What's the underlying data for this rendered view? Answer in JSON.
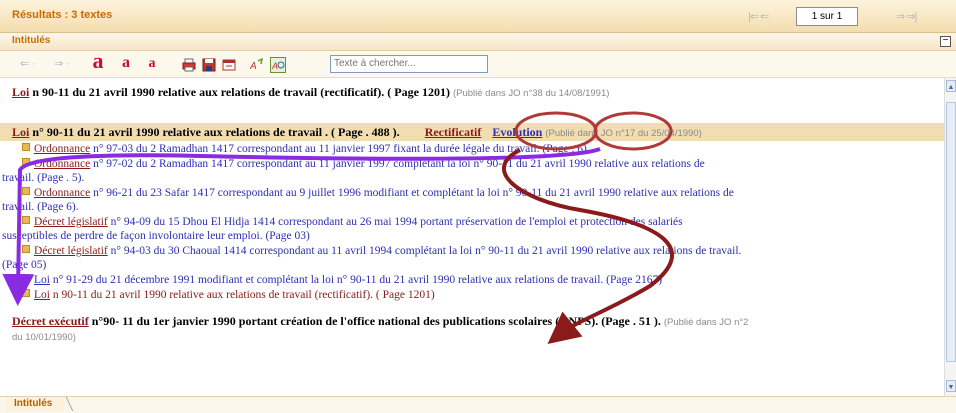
{
  "results": {
    "title": "Résultats : 3 textes",
    "page_indicator": "1 sur 1",
    "nav_prev": "|⇐ ⇐",
    "nav_next": "⇒ ⇒|"
  },
  "section": {
    "title": "Intitulés",
    "collapse": "−"
  },
  "toolbar": {
    "nav_back": "⇐ ·",
    "nav_fwd": "⇒ ·",
    "font_big": "a",
    "font_mid": "a",
    "font_small": "a",
    "search_placeholder": "Texte à chercher..."
  },
  "content": {
    "entry1": {
      "link": "Loi",
      "text": " n 90-11 du 21 avril 1990 relative aux relations de travail (rectificatif). ( Page 1201)",
      "pub": "(Publié dans JO n°38 du 14/08/1991)"
    },
    "entry2": {
      "link": "Loi",
      "text": " n° 90-11 du 21 avril 1990 relative aux relations de travail . ( Page . 488 ).",
      "btn_rectificatif": "Rectificatif",
      "btn_evolution": "Evolution",
      "pub": "(Publié dans JO n°17 du 25/04/1990)"
    },
    "subitems": [
      {
        "link": "Ordonnance",
        "text": " n° 97-03 du 2 Ramadhan 1417  correspondant au 11 janvier 1997 fixant la durée légale du travail. (Page . 6)."
      },
      {
        "link": "Ordonnance",
        "text": " n° 97-02 du 2 Ramadhan 1417  correspondant au 11 janvier 1997 complétant  la loi n° 90-11 du 21 avril 1990 relative aux relations de",
        "cont": "travail. (Page . 5)."
      },
      {
        "link": "Ordonnance",
        "text": " n° 96-21 du 23 Safar 1417 correspondant au 9 juillet 1996 modifiant et complétant la loi n° 90-11  du 21 avril 1990 relative aux relations de",
        "cont": "travail. (Page 6)."
      },
      {
        "link": "Décret législatif",
        "text": " n° 94-09 du 15 Dhou El Hidja 1414 correspondant au 26 mai 1994 portant préservation de l'emploi et protection des salariés",
        "cont": "susceptibles de perdre de façon involontaire leur emploi. (Page 03)"
      },
      {
        "link": "Décret législatif",
        "text": " n° 94-03 du 30 Chaoual 1414 correspondant au 11 avril 1994 complétant la loi n° 90-11 du 21 avril 1990 relative aux relations de travail.",
        "cont": "(Page 05)"
      },
      {
        "link": "Loi",
        "text": " n° 91-29 du 21 décembre 1991 modifiant et complétant la loi n° 90-11 du 21 avril 1990 relative aux relations de travail. (Page 2167)"
      },
      {
        "link": "Loi",
        "text": " n 90-11 du 21 avril 1990 relative aux relations de travail (rectificatif). ( Page 1201)"
      }
    ],
    "entry3": {
      "link": "Décret exécutif",
      "text": " n°90- 11 du 1er janvier 1990 portant création de l'office national des publications scolaires (ONPS). (Page . 51 ).",
      "pub": "(Publié dans JO n°2",
      "pub_cont": "du 10/01/1990)"
    }
  },
  "bottom": {
    "tab_label": "Intitulés"
  },
  "colors": {
    "accent_orange": "#cc6b00",
    "link_dark_red": "#8b1a1a",
    "link_blue": "#2e2fb3",
    "highlight_row": "#f2ddb3",
    "annotation_purple": "#8a2be2",
    "annotation_maroon": "#8b1a1a"
  }
}
